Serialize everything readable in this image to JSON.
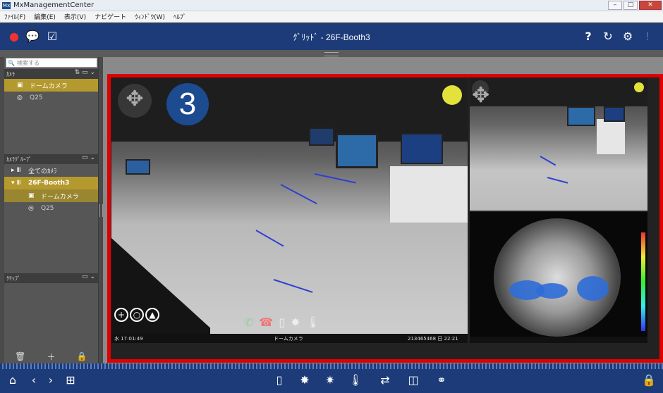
{
  "window": {
    "title": "MxManagementCenter",
    "controls": [
      "–",
      "□",
      "✕"
    ]
  },
  "menu": {
    "items": [
      "ﾌｧｲﾙ(F)",
      "編集(E)",
      "表示(V)",
      "ナビゲート",
      "ｳｨﾝﾄﾞｳ(W)",
      "ﾍﾙﾌﾟ"
    ]
  },
  "toolbar": {
    "title": "ｸﾞﾘｯﾄﾞ - 26F-Booth3",
    "icons": [
      "alarm-bell-icon",
      "chat-icon",
      "check-icon",
      "help-icon",
      "refresh-icon",
      "gear-icon",
      "lock-dim-icon"
    ]
  },
  "sidebar": {
    "search_placeholder": "検索する",
    "cameras_header": "ｶﾒﾗ",
    "cameras": [
      {
        "label": "ドームカメラ",
        "selected": true
      },
      {
        "label": "Q25",
        "selected": false
      }
    ],
    "groups_header": "ｶﾒﾗｸﾞﾙｰﾌﾟ",
    "groups": [
      {
        "label": "全てのｶﾒﾗ",
        "selected": false
      },
      {
        "label": "26F-Booth3",
        "selected": true
      }
    ],
    "group_children": [
      {
        "label": "ドームカメラ",
        "selected": true
      },
      {
        "label": "Q25",
        "selected": false
      }
    ],
    "clips_header": "ｸﾘｯﾌﾟ"
  },
  "viewer": {
    "badge": "3",
    "cam1_time": "水 17:01:49",
    "cam1_name": "ドームカメラ",
    "cam1_stamp": "213465468 日 22:21"
  },
  "colors": {
    "accent": "#1c3b78",
    "highlight": "#b49a2e",
    "frame": "#e00000"
  }
}
